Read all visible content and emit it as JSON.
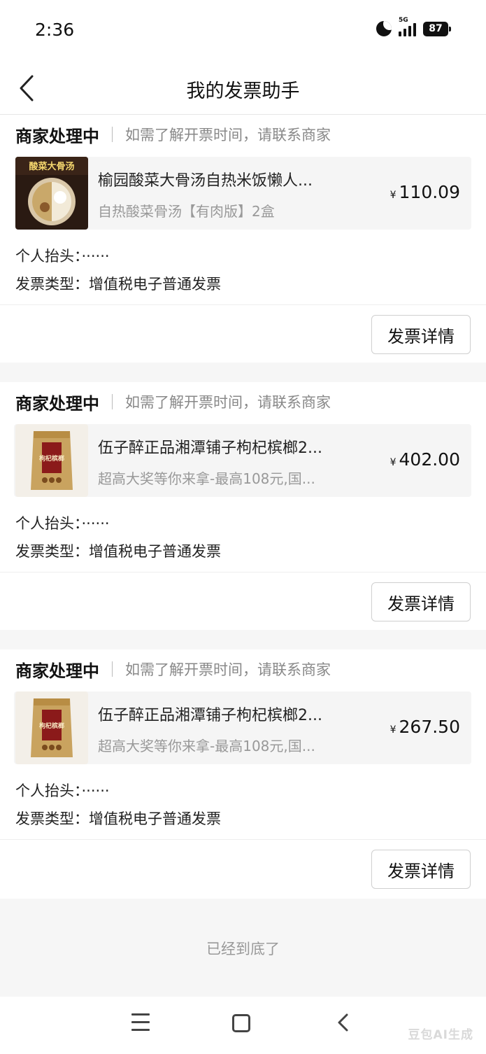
{
  "status_bar": {
    "time": "2:36",
    "network": "5G",
    "battery": "87"
  },
  "header": {
    "title": "我的发票助手"
  },
  "orders": [
    {
      "status": "商家处理中",
      "note": "如需了解开票时间，请联系商家",
      "product_name": "榆园酸菜大骨汤自热米饭懒人...",
      "product_spec": "自热酸菜骨汤【有肉版】2盒",
      "thumb_text": "酸菜大骨汤",
      "price_symbol": "¥",
      "price": "110.09",
      "title_label": "个人抬头：",
      "title_value": "······",
      "type_label": "发票类型：",
      "type_value": "增值税电子普通发票",
      "button_label": "发票详情"
    },
    {
      "status": "商家处理中",
      "note": "如需了解开票时间，请联系商家",
      "product_name": "伍子醉正品湘潭铺子枸杞槟榔2...",
      "product_spec": "超高大奖等你来拿-最高108元,国...",
      "thumb_text": "枸杞槟榔",
      "price_symbol": "¥",
      "price": "402.00",
      "title_label": "个人抬头：",
      "title_value": "······",
      "type_label": "发票类型：",
      "type_value": "增值税电子普通发票",
      "button_label": "发票详情"
    },
    {
      "status": "商家处理中",
      "note": "如需了解开票时间，请联系商家",
      "product_name": "伍子醉正品湘潭铺子枸杞槟榔2...",
      "product_spec": "超高大奖等你来拿-最高108元,国...",
      "thumb_text": "枸杞槟榔",
      "price_symbol": "¥",
      "price": "267.50",
      "title_label": "个人抬头：",
      "title_value": "······",
      "type_label": "发票类型：",
      "type_value": "增值税电子普通发票",
      "button_label": "发票详情"
    }
  ],
  "footer": {
    "end_text": "已经到底了"
  },
  "watermark": "豆包AI生成",
  "icons": {
    "back": "chevron-left-icon",
    "menu": "menu-icon",
    "home": "home-icon",
    "nav_back": "back-icon"
  }
}
